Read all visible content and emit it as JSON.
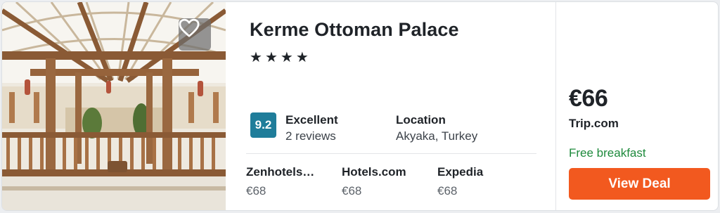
{
  "hotel": {
    "name": "Kerme Ottoman Palace",
    "stars": [
      "★",
      "★",
      "★",
      "★"
    ],
    "rating_score": "9.2",
    "rating_label": "Excellent",
    "reviews": "2 reviews",
    "location_label": "Location",
    "location": "Akyaka, Turkey",
    "favorite_icon": "heart-outline-icon"
  },
  "providers": [
    {
      "name": "Zenhotels…",
      "price": "€68"
    },
    {
      "name": "Hotels.com",
      "price": "€68"
    },
    {
      "name": "Expedia",
      "price": "€68"
    }
  ],
  "deal": {
    "price": "€66",
    "site": "Trip.com",
    "perk": "Free breakfast",
    "button_label": "View Deal"
  },
  "colors": {
    "badge": "#1f7d9a",
    "cta": "#f2591f",
    "perk": "#1e8a3c"
  }
}
